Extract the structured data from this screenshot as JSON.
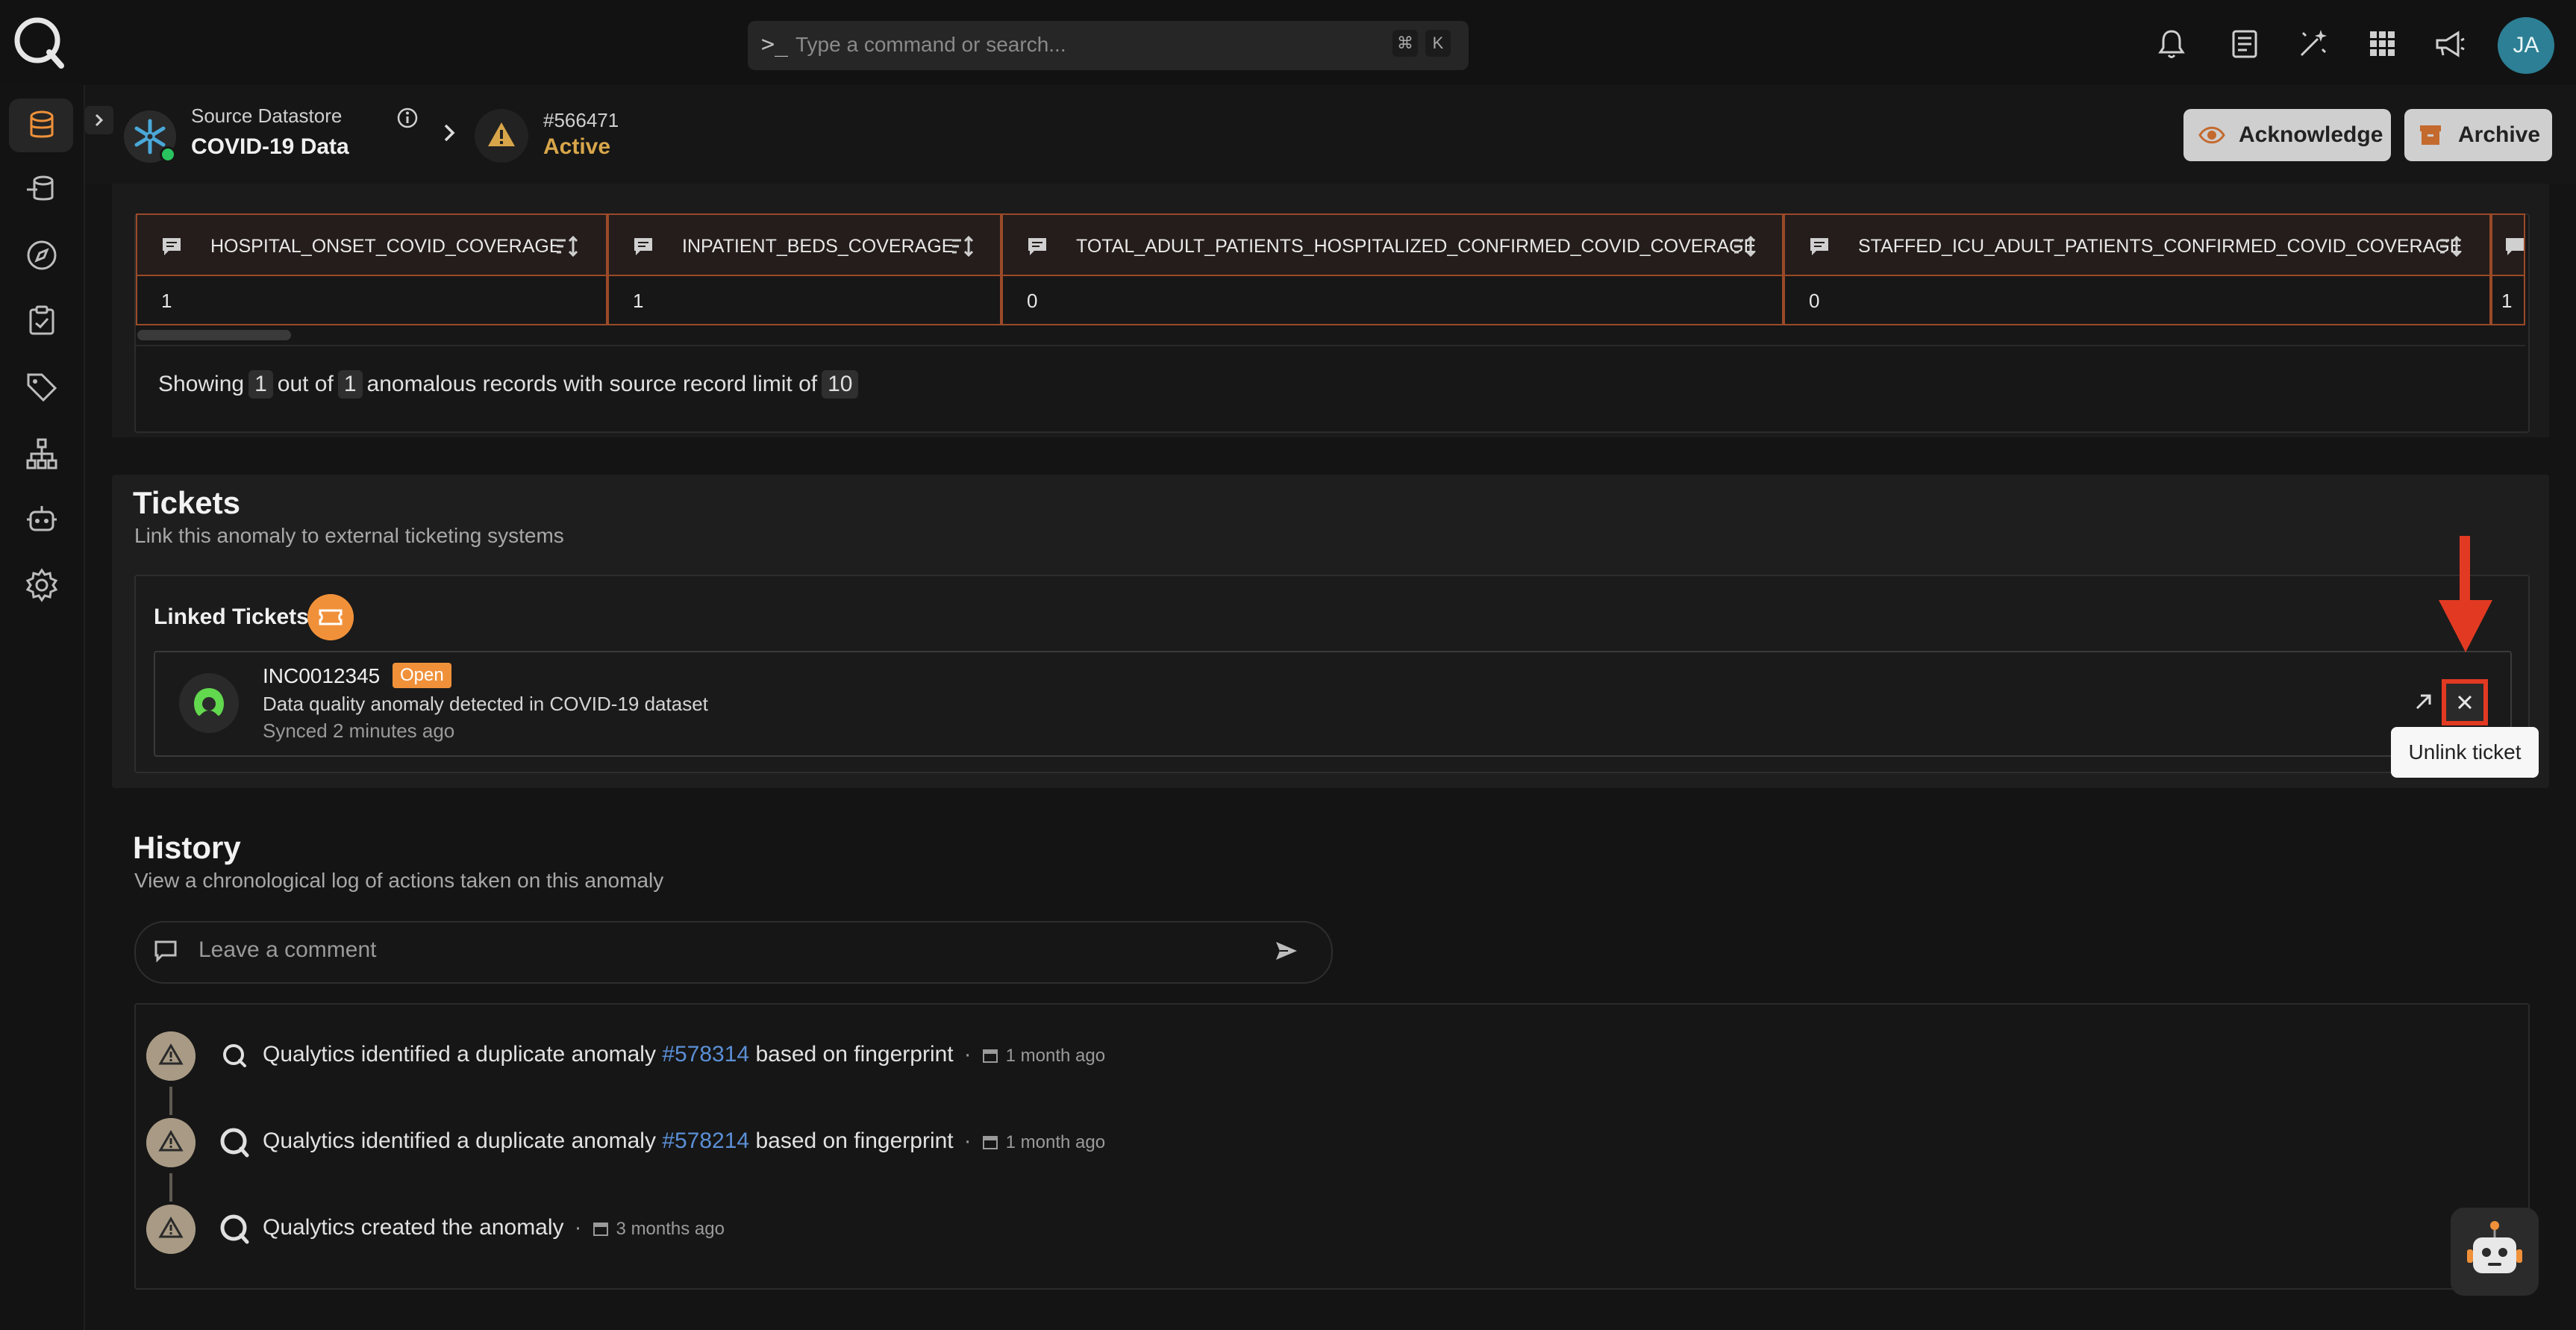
{
  "topbar": {
    "search_prompt": ">_",
    "search_placeholder": "Type a command or search...",
    "shortcut_keys": [
      "⌘",
      "K"
    ],
    "icons": [
      "bell-icon",
      "document-icon",
      "magic-wand-icon",
      "grid-icon",
      "megaphone-icon"
    ],
    "avatar_initials": "JA"
  },
  "sidebar": {
    "items": [
      "datastore-icon",
      "enrichment-icon",
      "explore-icon",
      "checks-icon",
      "tags-icon",
      "lineage-icon",
      "agents-icon",
      "settings-icon"
    ],
    "active": "datastore-icon"
  },
  "header": {
    "kicker": "Source Datastore",
    "datastore_name": "COVID-19 Data",
    "anomaly_id": "#566471",
    "status": "Active",
    "acknowledge_label": "Acknowledge",
    "archive_label": "Archive",
    "status_color": "#d8a64a"
  },
  "records": {
    "columns": [
      {
        "name": "HOSPITAL_ONSET_COVID_COVERAGE",
        "value": "1"
      },
      {
        "name": "INPATIENT_BEDS_COVERAGE",
        "value": "1"
      },
      {
        "name": "TOTAL_ADULT_PATIENTS_HOSPITALIZED_CONFIRMED_COVID_COVERAGE",
        "value": "0"
      },
      {
        "name": "STAFFED_ICU_ADULT_PATIENTS_CONFIRMED_COVID_COVERAGE",
        "value": "0"
      },
      {
        "name": "",
        "value": "1"
      }
    ],
    "summary": {
      "prefix": "Showing",
      "shown": "1",
      "middle": "out of",
      "total": "1",
      "suffix": "anomalous records with source record limit of",
      "limit": "10"
    }
  },
  "tickets": {
    "title": "Tickets",
    "subtitle": "Link this anomaly to external ticketing systems",
    "linked_label": "Linked Tickets",
    "ticket": {
      "number": "INC0012345",
      "status": "Open",
      "description": "Data quality anomaly detected in COVID-19 dataset",
      "synced": "Synced 2 minutes ago"
    },
    "tooltip": "Unlink ticket",
    "highlight_color": "#e23a22"
  },
  "history": {
    "title": "History",
    "subtitle": "View a chronological log of actions taken on this anomaly",
    "comment_placeholder": "Leave a comment",
    "entries": [
      {
        "pre": "Qualytics identified a duplicate anomaly",
        "link": "#578314",
        "post": "based on fingerprint",
        "time": "1 month ago"
      },
      {
        "pre": "Qualytics identified a duplicate anomaly",
        "link": "#578214",
        "post": "based on fingerprint",
        "time": "1 month ago"
      },
      {
        "pre": "Qualytics created the anomaly",
        "link": "",
        "post": "",
        "time": "3 months ago"
      }
    ]
  }
}
